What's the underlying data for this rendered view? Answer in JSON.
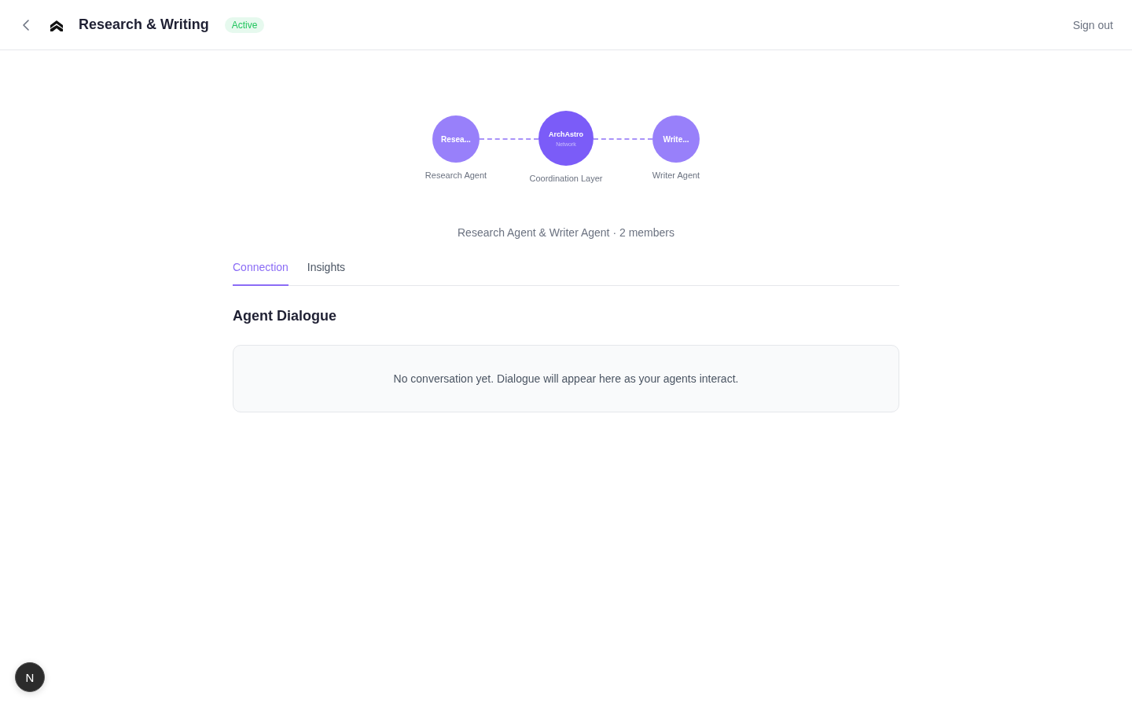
{
  "header": {
    "title": "Research & Writing",
    "status": "Active",
    "sign_out": "Sign out"
  },
  "network": {
    "nodes": [
      {
        "kind": "agent",
        "text": "Resea...",
        "label": "Research Agent"
      },
      {
        "kind": "hub",
        "text": "ArchAstro",
        "subtext": "Network",
        "label": "Coordination Layer"
      },
      {
        "kind": "agent",
        "text": "Write...",
        "label": "Writer Agent"
      }
    ]
  },
  "summary": "Research Agent & Writer Agent · 2 members",
  "tabs": [
    {
      "label": "Connection",
      "selected": true
    },
    {
      "label": "Insights",
      "selected": false
    }
  ],
  "section": {
    "title": "Agent Dialogue",
    "empty_message": "No conversation yet. Dialogue will appear here as your agents interact."
  },
  "dev_badge": "N"
}
